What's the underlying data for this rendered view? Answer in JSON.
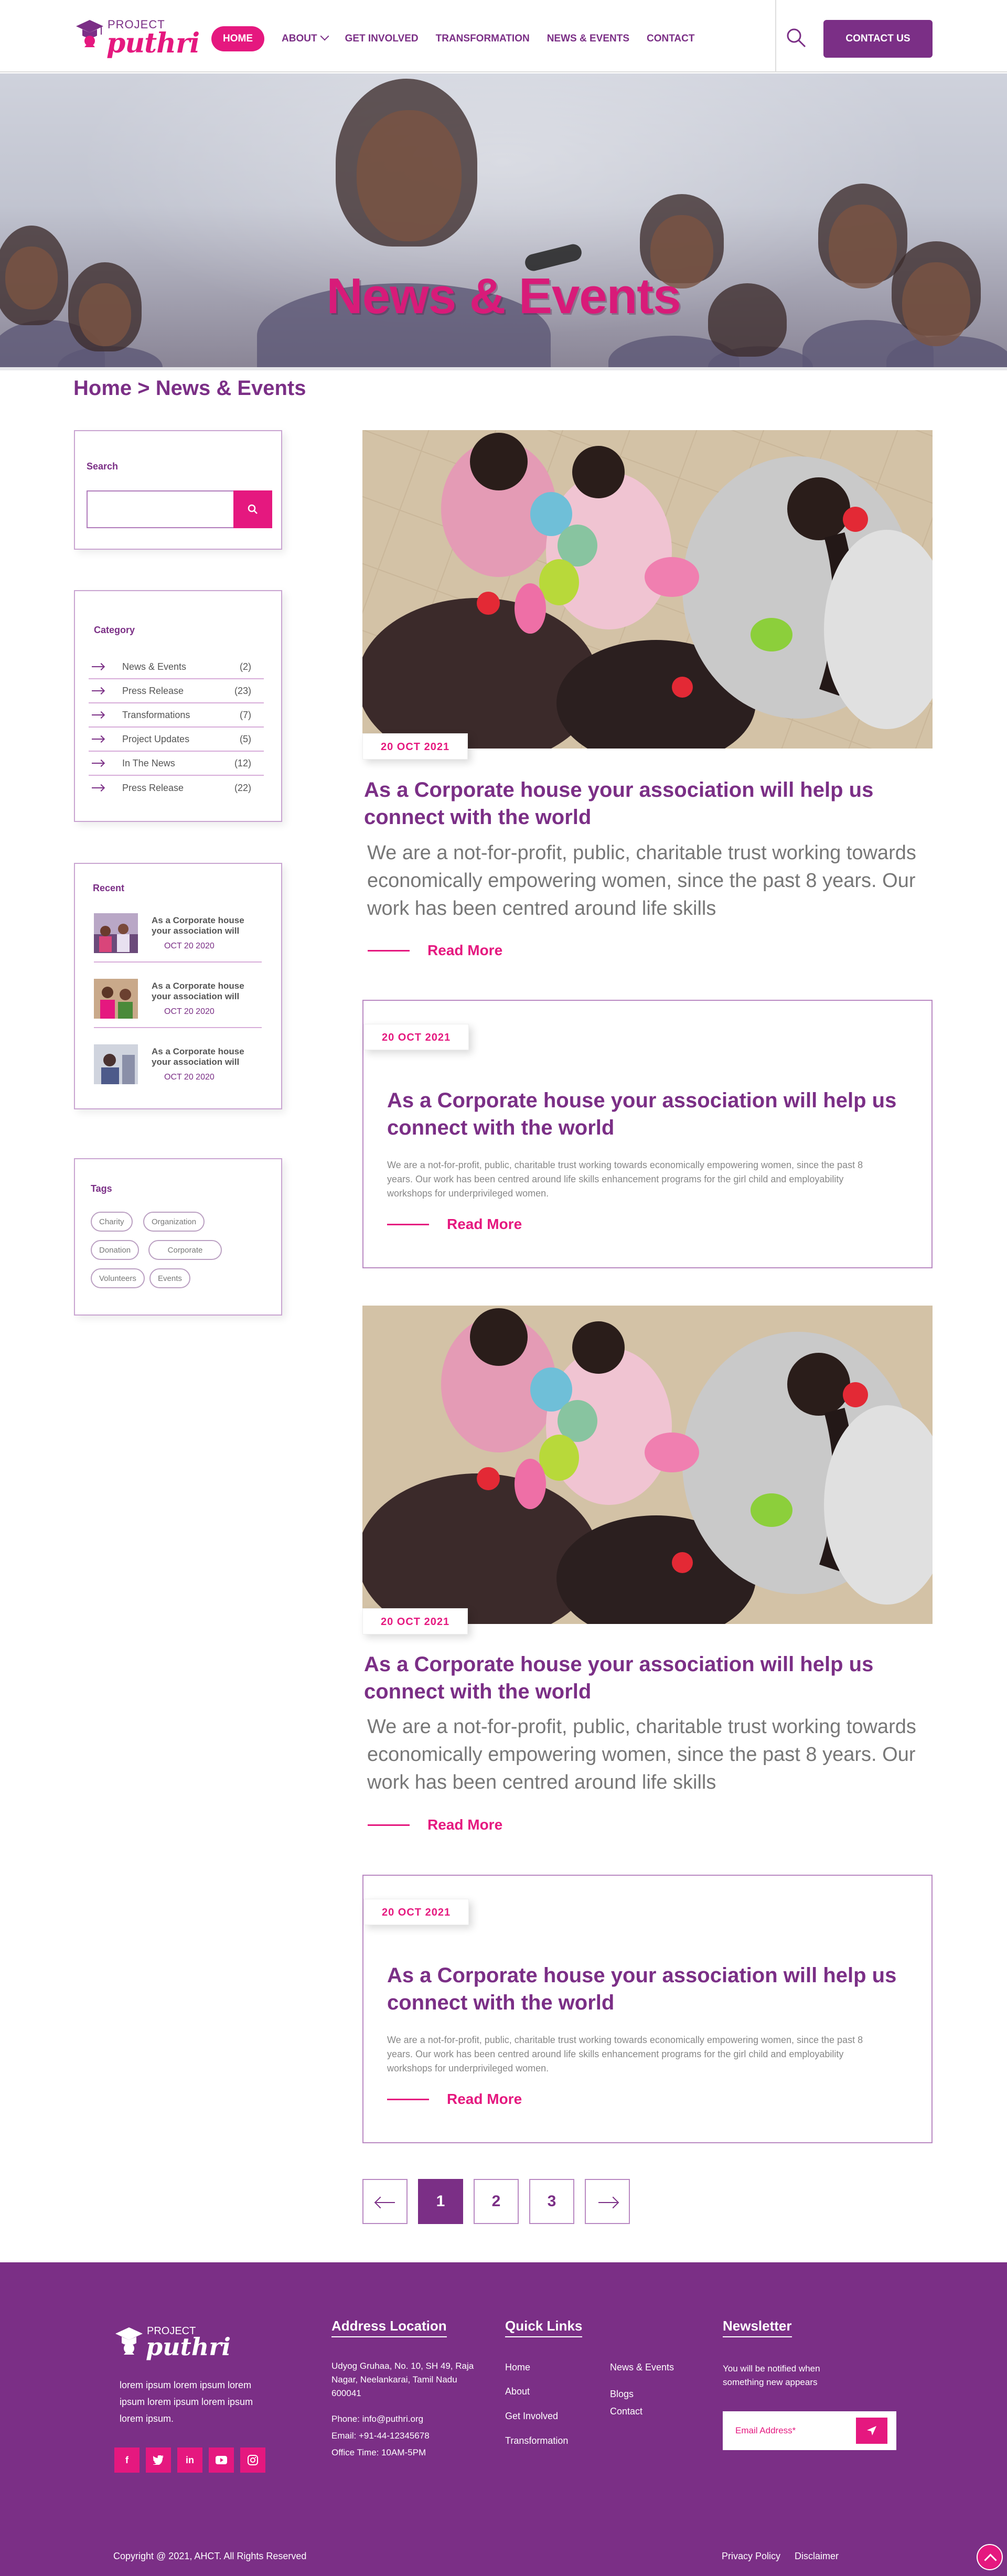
{
  "header": {
    "logo_project": "PROJECT",
    "logo_name": "puthri",
    "nav": [
      {
        "label": "HOME"
      },
      {
        "label": "ABOUT"
      },
      {
        "label": "GET INVOLVED"
      },
      {
        "label": "TRANSFORMATION"
      },
      {
        "label": "NEWS & EVENTS"
      },
      {
        "label": "CONTACT"
      }
    ],
    "contact_button": "CONTACT US"
  },
  "hero": {
    "title": "News & Events"
  },
  "breadcrumb": "Home > News & Events",
  "sidebar": {
    "search": {
      "title": "Search",
      "placeholder": ""
    },
    "category": {
      "title": "Category",
      "items": [
        {
          "label": "News & Events",
          "count": "(2)"
        },
        {
          "label": "Press Release",
          "count": "(23)"
        },
        {
          "label": "Transformations",
          "count": "(7)"
        },
        {
          "label": "Project Updates",
          "count": "(5)"
        },
        {
          "label": "In The News",
          "count": "(12)"
        },
        {
          "label": "Press Release",
          "count": "(22)"
        }
      ]
    },
    "recent": {
      "title": "Recent",
      "items": [
        {
          "title": "As a Corporate house your association  will",
          "date": "OCT 20 2020"
        },
        {
          "title": "As a Corporate house your association  will",
          "date": "OCT 20 2020"
        },
        {
          "title": "As a Corporate house your association  will",
          "date": "OCT 20 2020"
        }
      ]
    },
    "tags": {
      "title": "Tags",
      "items": [
        "Charity",
        "Organization",
        "Donation",
        "Corporate",
        "Volunteers",
        "Events"
      ]
    }
  },
  "posts": [
    {
      "date": "20 OCT 2021",
      "title": "As a Corporate house your association  will help us connect with the world",
      "desc": "We are a not-for-profit, public, charitable trust working towards economically empowering women, since the past 8 years. Our work has been centred around life skills",
      "read_more": "Read More"
    },
    {
      "date": "20 OCT 2021",
      "title": "As a Corporate house your association  will help us connect with the world",
      "desc": "We are a not-for-profit, public, charitable trust working towards economically empowering women, since the past 8 years. Our work has been centred around life skills enhancement programs for the girl child and employability workshops for underprivileged women.",
      "read_more": "Read More"
    },
    {
      "date": "20 OCT 2021",
      "title": "As a Corporate house your association  will help us connect with the world",
      "desc": "We are a not-for-profit, public, charitable trust working towards economically empowering women, since the past 8 years. Our work has been centred around life skills",
      "read_more": "Read More"
    },
    {
      "date": "20 OCT 2021",
      "title": "As a Corporate house your association  will help us connect with the world",
      "desc": "We are a not-for-profit, public, charitable trust working towards economically empowering women, since the past 8 years. Our work has been centred around life skills enhancement programs for the girl child and employability workshops for underprivileged women.",
      "read_more": "Read More"
    }
  ],
  "pagination": {
    "pages": [
      "1",
      "2",
      "3"
    ],
    "current": "1"
  },
  "footer": {
    "logo_project": "PROJECT",
    "logo_name": "puthri",
    "about": "lorem ipsum lorem ipsum lorem ipsum lorem ipsum lorem ipsum lorem ipsum.",
    "address_title": "Address Location",
    "address": "Udyog Gruhaa, No. 10, SH 49, Raja Nagar, Neelankarai, Tamil Nadu 600041",
    "phone": "Phone: info@puthri.org",
    "email": "Email: +91-44-12345678",
    "office": "Office Time: 10AM-5PM",
    "quick_links_title": "Quick Links",
    "links_col1": [
      "Home",
      "About",
      "Get Involved",
      "Transformation"
    ],
    "links_col2": [
      "News & Events",
      "Blogs",
      "Contact"
    ],
    "newsletter_title": "Newsletter",
    "newsletter_text": "You will be notified when something new appears",
    "email_placeholder": "Email Address*",
    "copyright": "Copyright @ 2021, AHCT. All Rights Reserved",
    "privacy": "Privacy Policy",
    "disclaimer": "Disclaimer",
    "socials": [
      "facebook-icon",
      "twitter-icon",
      "linkedin-icon",
      "youtube-icon",
      "instagram-icon"
    ]
  },
  "colors": {
    "primary": "#7b2f86",
    "accent": "#e5187f"
  }
}
